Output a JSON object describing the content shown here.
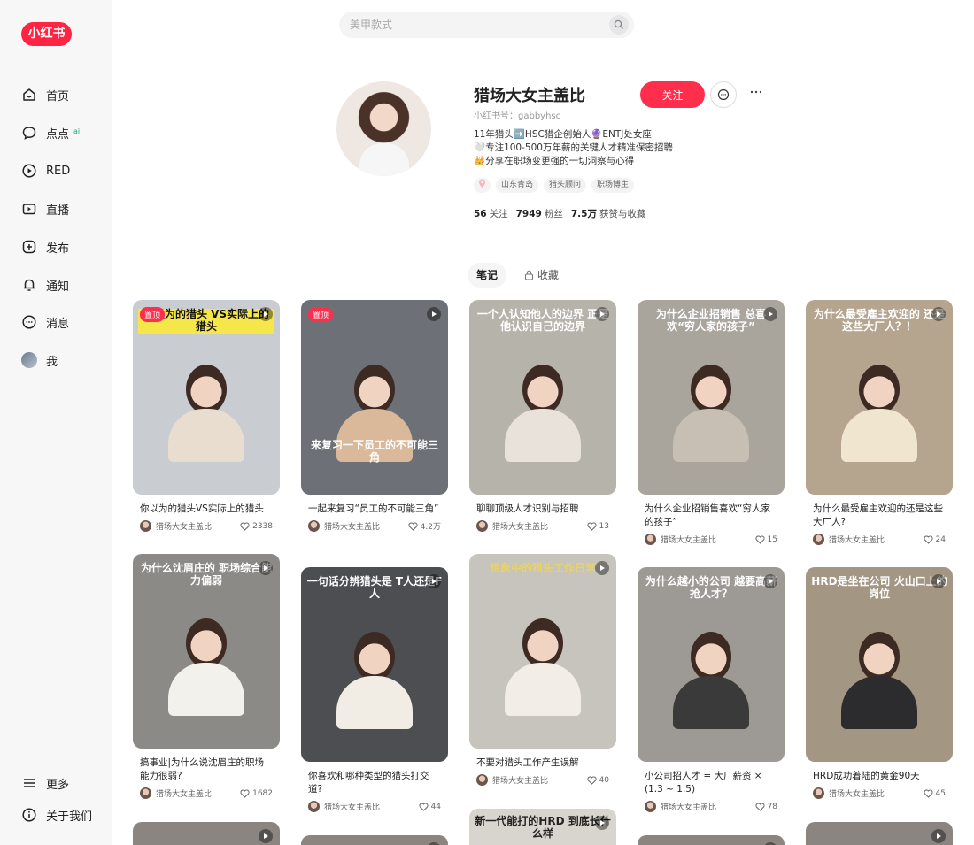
{
  "app": {
    "logo": "小红书"
  },
  "search": {
    "placeholder": "美甲款式"
  },
  "sidebar": {
    "items": [
      {
        "label": "首页",
        "icon": "home-icon"
      },
      {
        "label": "点点",
        "icon": "chat-bubble-icon",
        "badge": "ai"
      },
      {
        "label": "RED",
        "icon": "play-circle-icon"
      },
      {
        "label": "直播",
        "icon": "live-icon"
      },
      {
        "label": "发布",
        "icon": "plus-square-icon"
      },
      {
        "label": "通知",
        "icon": "bell-icon"
      },
      {
        "label": "消息",
        "icon": "message-icon"
      },
      {
        "label": "我",
        "icon": "avatar"
      }
    ],
    "bottom": [
      {
        "label": "更多",
        "icon": "menu-icon"
      },
      {
        "label": "关于我们",
        "icon": "info-icon"
      }
    ]
  },
  "profile": {
    "name": "猎场大女主盖比",
    "id": "小红书号：gabbyhsc",
    "bio": [
      "11年猎头➡️HSC猎企创始人🔮ENTJ处女座",
      "🤍专注100-500万年薪的关键人才精准保密招聘",
      "👑分享在职场变更强的一切洞察与心得"
    ],
    "tags": [
      "山东青岛",
      "猎头顾问",
      "职场博主"
    ],
    "follow_label": "关注",
    "stats": [
      {
        "value": "56",
        "label": "关注"
      },
      {
        "value": "7949",
        "label": "粉丝"
      },
      {
        "value": "7.5万",
        "label": "获赞与收藏"
      }
    ]
  },
  "tabs": [
    {
      "label": "笔记",
      "active": true
    },
    {
      "label": "收藏",
      "active": false,
      "icon": "lock-icon"
    }
  ],
  "author": "猎场大女主盖比",
  "pinned_label": "置顶",
  "notes": [
    {
      "title": "你以为的猎头VS实际上的猎头",
      "likes": "2338",
      "pinned": true,
      "caption": "你以为的猎头 VS实际上的猎头",
      "bg": "#c9cdd2",
      "captionBg": "#f5e64a",
      "captionColor": "#111"
    },
    {
      "title": "一起来复习“员工的不可能三角”",
      "likes": "4.2万",
      "pinned": true,
      "caption": "来复习一下员工的不可能三角",
      "bg": "#6d7177",
      "captionBg": "transparent",
      "captionColor": "#fff"
    },
    {
      "title": "聊聊顶级人才识别与招聘",
      "likes": "13",
      "pinned": false,
      "caption": "一个人认知他人的边界 正是他认识自己的边界",
      "bg": "#b6b3aa",
      "captionBg": "transparent",
      "captionColor": "#fff"
    },
    {
      "title": "为什么企业招销售喜欢“穷人家的孩子”",
      "likes": "15",
      "pinned": false,
      "caption": "为什么企业招销售 总喜欢“穷人家的孩子”",
      "bg": "#a9a49c",
      "captionBg": "transparent",
      "captionColor": "#fff"
    },
    {
      "title": "为什么最受雇主欢迎的还是这些大厂人?",
      "likes": "24",
      "pinned": false,
      "caption": "为什么最受雇主欢迎的 还是这些大厂人？！",
      "bg": "#b5a58e",
      "captionBg": "transparent",
      "captionColor": "#fff"
    },
    {
      "title": "搞事业|为什么说沈眉庄的职场能力很弱?",
      "likes": "1682",
      "pinned": false,
      "caption": "为什么沈眉庄的 职场综合能力偏弱",
      "bg": "#8c8a86",
      "captionBg": "transparent",
      "captionColor": "#fff"
    },
    {
      "title": "你喜欢和哪种类型的猎头打交道?",
      "likes": "44",
      "pinned": false,
      "caption": "一句话分辨猎头是 T人还是F人",
      "bg": "#4d4e52",
      "captionBg": "transparent",
      "captionColor": "#fff"
    },
    {
      "title": "不要对猎头工作产生误解",
      "likes": "40",
      "pinned": false,
      "caption": "想象中的猎头工作日常",
      "bg": "#c7c3bd",
      "captionBg": "transparent",
      "captionColor": "#e8d36a"
    },
    {
      "title": "小公司招人才 = 大厂薪资 × (1.3 ~ 1.5)",
      "likes": "78",
      "pinned": false,
      "caption": "为什么越小的公司 越要高薪抢人才？",
      "bg": "#9d9a95",
      "captionBg": "transparent",
      "captionColor": "#fff"
    },
    {
      "title": "HRD成功着陆的黄金90天",
      "likes": "45",
      "pinned": false,
      "caption": "HRD是坐在公司 火山口上的岗位",
      "bg": "#a39683",
      "captionBg": "transparent",
      "captionColor": "#fff"
    }
  ],
  "partial_cards": [
    {
      "caption": ""
    },
    {
      "caption": ""
    },
    {
      "caption": "新一代能打的HRD 到底长什么样"
    },
    {
      "caption": ""
    },
    {
      "caption": ""
    }
  ],
  "colors": {
    "brand": "#ff2442",
    "follow": "#ff2e4d"
  }
}
